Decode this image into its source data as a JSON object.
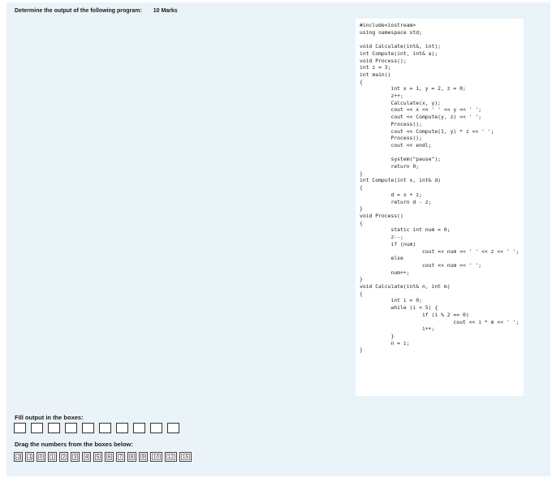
{
  "question": {
    "prompt": "Determine the output of the following program:",
    "marks": "10 Marks"
  },
  "code_lines": [
    "#include<iostream>",
    "using namespace std;",
    "",
    "void Calculate(int&, int);",
    "int Compute(int, int& a);",
    "void Process();",
    "int z = 3;",
    "int main()",
    "{",
    "          int x = 1, y = 2, z = 0;",
    "          z++;",
    "          Calculate(x, y);",
    "          cout << x << ' ' << y << ' ';",
    "          cout << Compute(y, z) << ' ';",
    "          Process();",
    "          cout << Compute(1, y) * z << ' ';",
    "          Process();",
    "          cout << endl;",
    "",
    "          system(\"pause\");",
    "          return 0;",
    "}",
    "int Compute(int x, int& d)",
    "{",
    "          d = x + z;",
    "          return d - z;",
    "}",
    "void Process()",
    "{",
    "          static int num = 0;",
    "          z--;",
    "          if (num)",
    "                    cout << num << ' ' << z << ' ';",
    "          else",
    "                    cout << num << ' ';",
    "          num++;",
    "}",
    "void Calculate(int& n, int m)",
    "{",
    "          int i = 0;",
    "          while (i < 5) {",
    "                    if (i % 2 == 0)",
    "                              cout << i * m << ' ';",
    "                    i++;",
    "          }",
    "          n = i;",
    "}"
  ],
  "fill": {
    "label": "Fill output in the boxes:",
    "box_count": 10
  },
  "drag": {
    "label": "Drag the numbers from the boxes below:",
    "numbers": [
      "-2",
      "-1",
      "0",
      "1",
      "2",
      "3",
      "4",
      "5",
      "6",
      "7",
      "8",
      "9",
      "10",
      "12",
      "15"
    ]
  }
}
